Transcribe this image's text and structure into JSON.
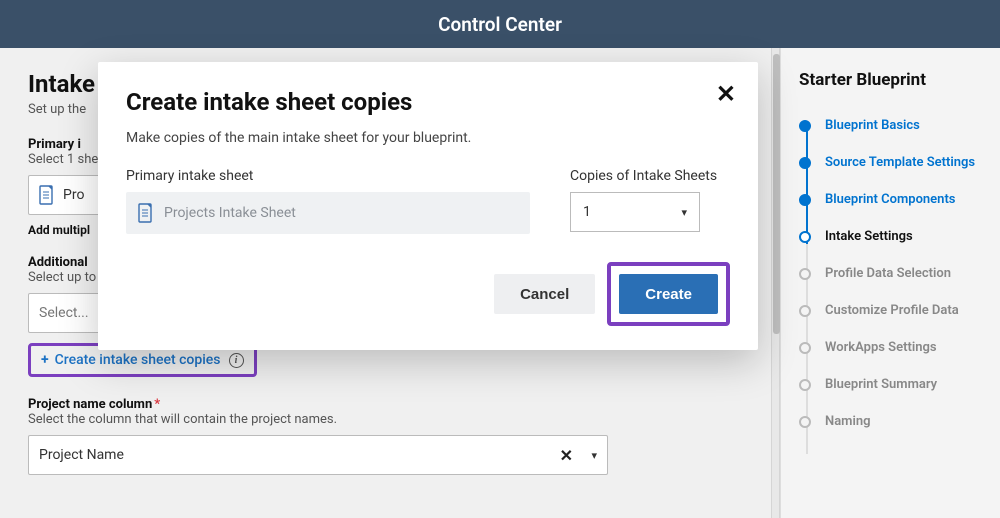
{
  "header": {
    "title": "Control Center"
  },
  "page": {
    "title_partial": "Intake",
    "subtitle_partial": "Set up the",
    "primary_label": "Primary i",
    "primary_help": "Select 1 she",
    "primary_value": "Pro",
    "add_multiple_partial": "Add multipl",
    "additional_label": "Additional",
    "additional_help": "Select up to",
    "additional_placeholder": "Select...",
    "create_copies_link": "Create intake sheet copies",
    "project_col_label": "Project name column",
    "project_col_help": "Select the column that will contain the project names.",
    "project_col_value": "Project Name"
  },
  "modal": {
    "title": "Create intake sheet copies",
    "description": "Make copies of the main intake sheet for your blueprint.",
    "primary_label": "Primary intake sheet",
    "primary_value": "Projects Intake Sheet",
    "copies_label": "Copies of Intake Sheets",
    "copies_value": "1",
    "cancel": "Cancel",
    "create": "Create"
  },
  "sidebar": {
    "title": "Starter Blueprint",
    "steps": [
      {
        "label": "Blueprint Basics",
        "state": "done"
      },
      {
        "label": "Source Template Settings",
        "state": "done"
      },
      {
        "label": "Blueprint Components",
        "state": "done"
      },
      {
        "label": "Intake Settings",
        "state": "current"
      },
      {
        "label": "Profile Data Selection",
        "state": "todo"
      },
      {
        "label": "Customize Profile Data",
        "state": "todo"
      },
      {
        "label": "WorkApps Settings",
        "state": "todo"
      },
      {
        "label": "Blueprint Summary",
        "state": "todo"
      },
      {
        "label": "Naming",
        "state": "todo"
      }
    ]
  }
}
